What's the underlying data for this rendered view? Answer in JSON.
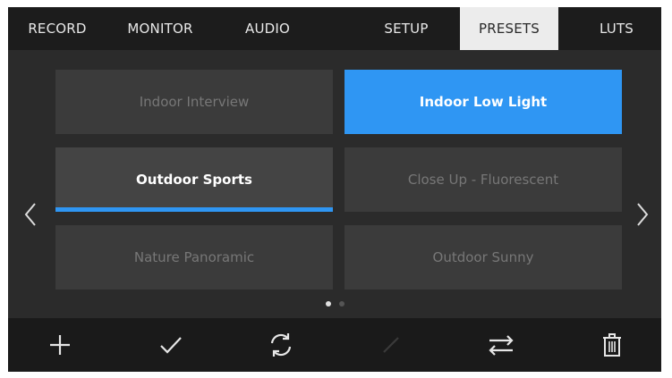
{
  "tabs": [
    {
      "label": "RECORD",
      "active": false
    },
    {
      "label": "MONITOR",
      "active": false
    },
    {
      "label": "AUDIO",
      "active": false
    },
    {
      "label": "SETUP",
      "active": false
    },
    {
      "label": "PRESETS",
      "active": true
    },
    {
      "label": "LUTS",
      "active": false
    }
  ],
  "presets": [
    {
      "label": "Indoor Interview",
      "state": "normal"
    },
    {
      "label": "Indoor Low Light",
      "state": "selected"
    },
    {
      "label": "Outdoor Sports",
      "state": "focused"
    },
    {
      "label": "Close Up - Fluorescent",
      "state": "normal"
    },
    {
      "label": "Nature Panoramic",
      "state": "normal"
    },
    {
      "label": "Outdoor Sunny",
      "state": "normal"
    }
  ],
  "pagination": {
    "current_page": 1,
    "total_pages": 2
  },
  "navigation": {
    "prev_icon": "chevron-left-icon",
    "next_icon": "chevron-right-icon"
  },
  "toolbar": [
    {
      "icon": "plus-icon",
      "enabled": true
    },
    {
      "icon": "checkmark-icon",
      "enabled": true
    },
    {
      "icon": "refresh-icon",
      "enabled": true
    },
    {
      "icon": "pencil-icon",
      "enabled": false
    },
    {
      "icon": "swap-arrows-icon",
      "enabled": true
    },
    {
      "icon": "trash-icon",
      "enabled": true
    }
  ],
  "colors": {
    "accent": "#2f96f3",
    "tab_active_bg": "#ececec",
    "tile_bg": "#3b3b3b",
    "screen_bg": "#2b2b2b"
  }
}
